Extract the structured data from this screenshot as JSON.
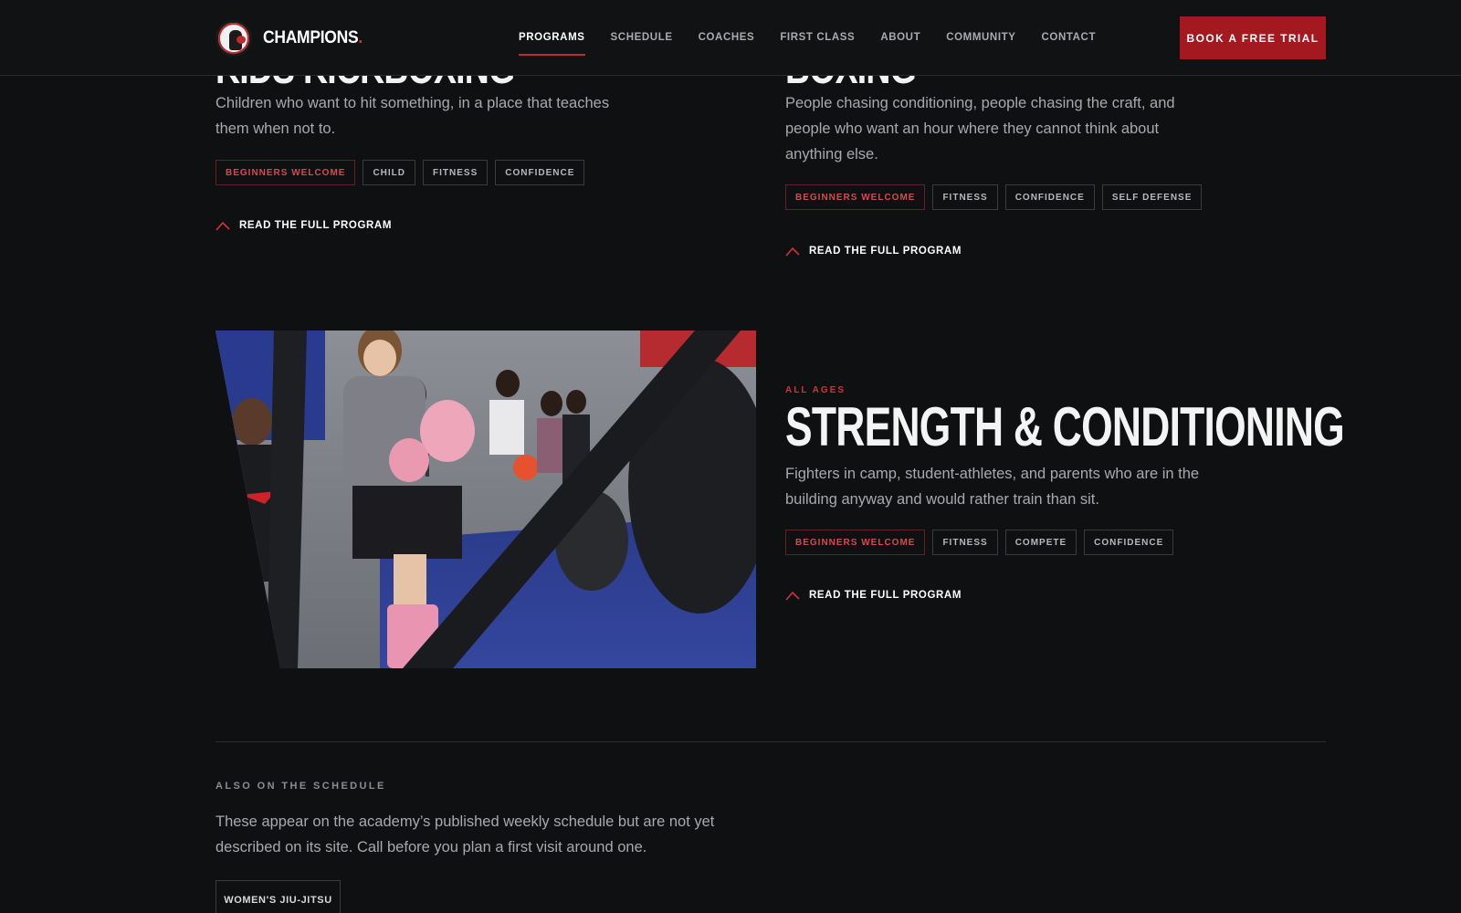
{
  "header": {
    "brand": "CHAMPIONS",
    "brand_dot": ".",
    "nav": [
      {
        "label": "PROGRAMS",
        "active": true
      },
      {
        "label": "SCHEDULE"
      },
      {
        "label": "COACHES"
      },
      {
        "label": "FIRST CLASS"
      },
      {
        "label": "ABOUT"
      },
      {
        "label": "COMMUNITY"
      },
      {
        "label": "CONTACT"
      }
    ],
    "cta": "BOOK A FREE TRIAL"
  },
  "programs": {
    "left": {
      "title_cut": "KIDS KICKBOXING",
      "description": "Children who want to hit something, in a place that teaches them when not to.",
      "tags": [
        "BEGINNERS WELCOME",
        "CHILD",
        "FITNESS",
        "CONFIDENCE"
      ],
      "link": "READ THE FULL PROGRAM"
    },
    "right": {
      "title_cut": "BOXING",
      "description": "People chasing conditioning, people chasing the craft, and people who want an hour where they cannot think about anything else.",
      "tags": [
        "BEGINNERS WELCOME",
        "FITNESS",
        "CONFIDENCE",
        "SELF DEFENSE"
      ],
      "link": "READ THE FULL PROGRAM"
    },
    "featured": {
      "eyebrow": "ALL AGES",
      "title": "STRENGTH & CONDITIONING",
      "description": "Fighters in camp, student-athletes, and parents who are in the building anyway and would rather train than sit.",
      "tags": [
        "BEGINNERS WELCOME",
        "FITNESS",
        "COMPETE",
        "CONFIDENCE"
      ],
      "link": "READ THE FULL PROGRAM",
      "photo_icon": "kids-kickboxing-class-photo"
    }
  },
  "also": {
    "label": "ALSO ON THE SCHEDULE",
    "description": "These appear on the academy’s published weekly schedule but are not yet described on its site. Call before you plan a first visit around one.",
    "chips": [
      "WOMEN'S JIU-JITSU"
    ]
  },
  "colors": {
    "accent": "#c1272d",
    "background": "#0f1012",
    "tag_hot": "#d64a50"
  }
}
